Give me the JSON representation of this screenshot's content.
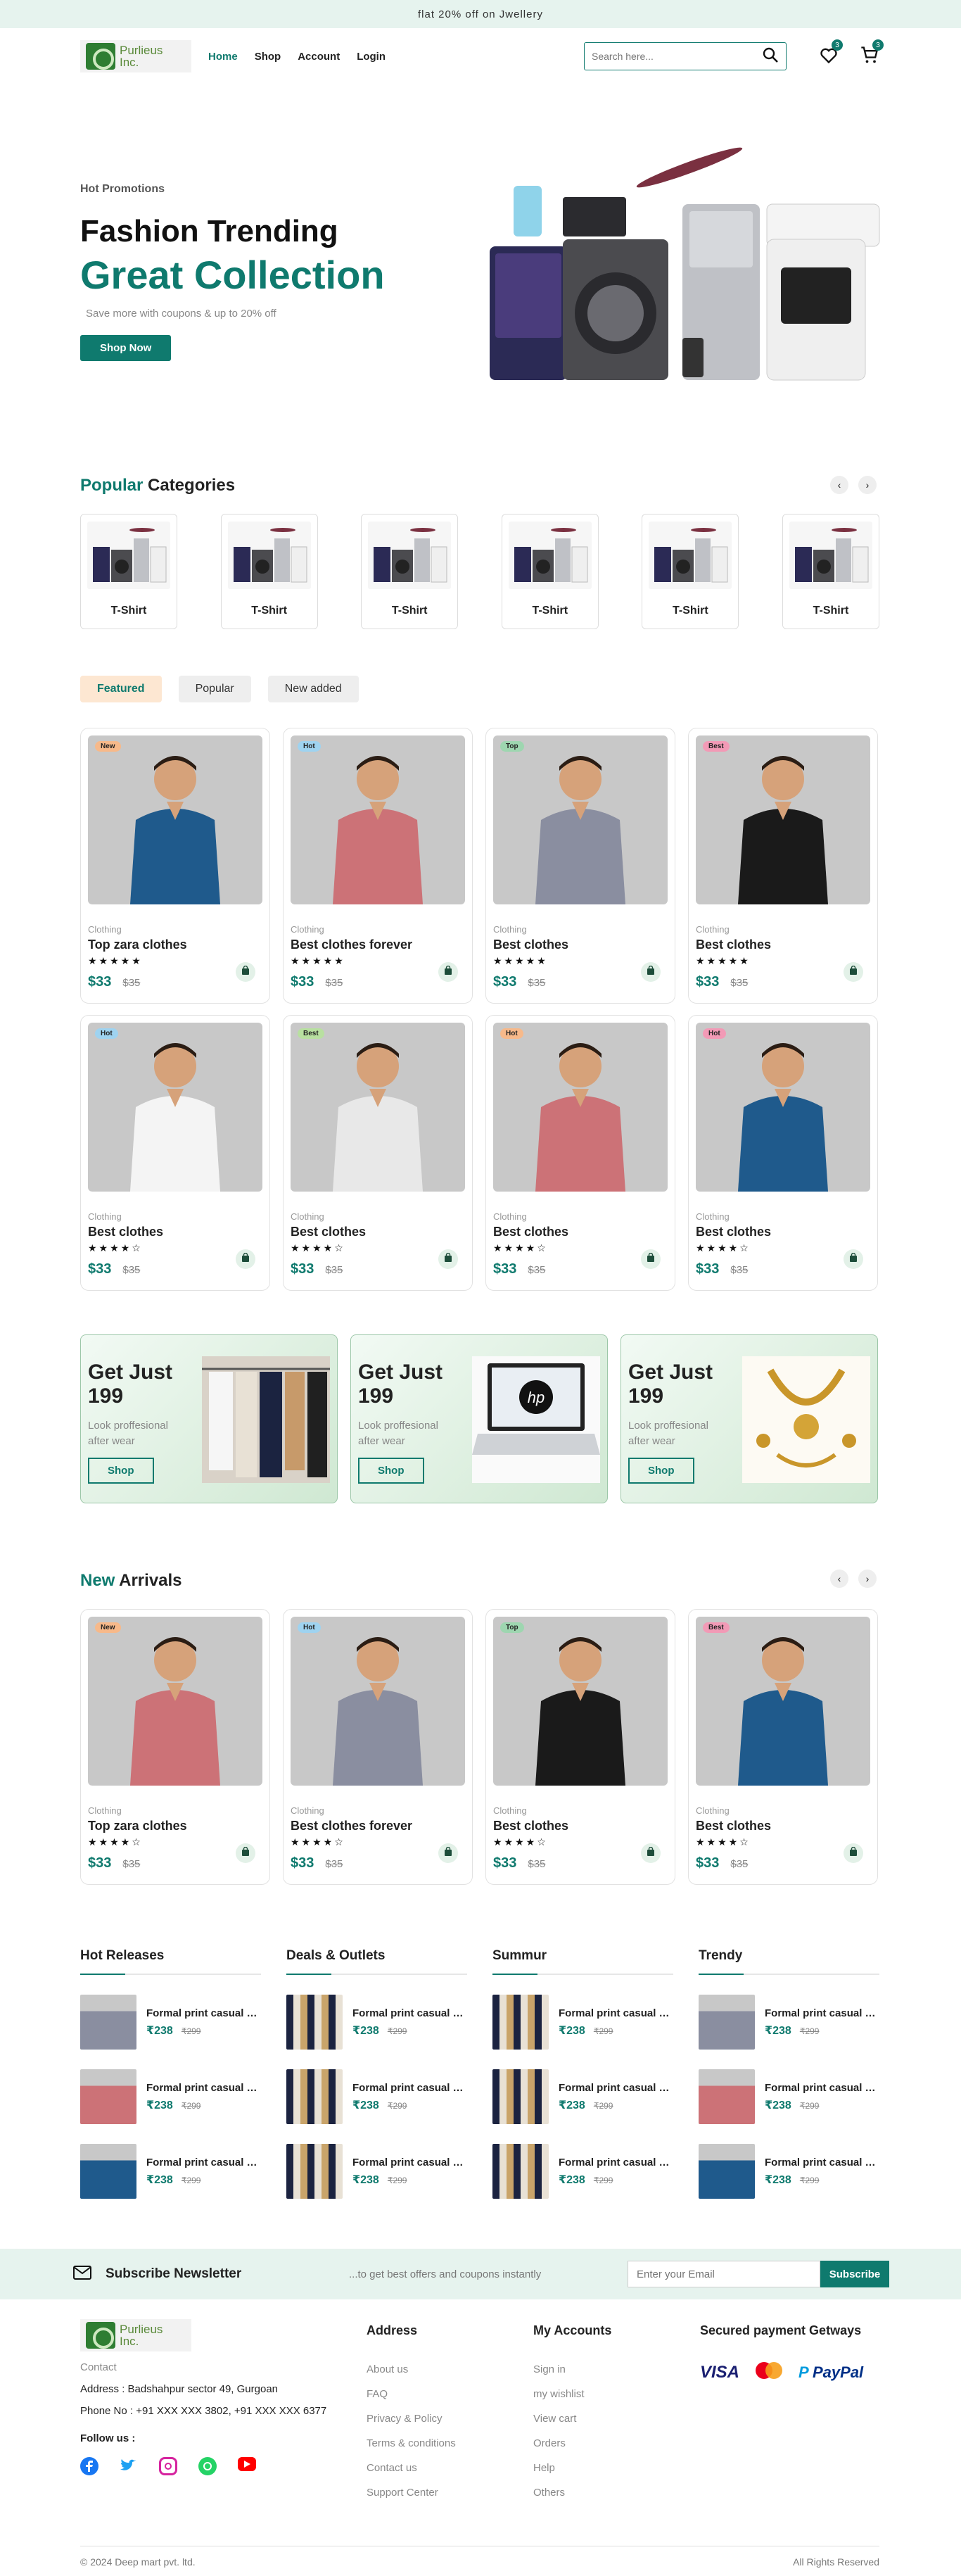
{
  "topbar": {
    "text": "flat 20% off on Jwellery"
  },
  "brand": {
    "logo_text_1": "Purlieus",
    "logo_text_2": "Inc."
  },
  "nav": {
    "home": "Home",
    "shop": "Shop",
    "account": "Account",
    "login": "Login"
  },
  "search": {
    "placeholder": "Search here..."
  },
  "badges": {
    "wishlist": "3",
    "cart": "3"
  },
  "hero": {
    "promo": "Hot Promotions",
    "title": "Fashion Trending",
    "subtitle": "Great Collection",
    "text": "Save more with coupons & up to 20% off",
    "button": "Shop Now"
  },
  "categories": {
    "title_accent": "Popular",
    "title_rest": " Categories",
    "items": [
      {
        "label": "T-Shirt"
      },
      {
        "label": "T-Shirt"
      },
      {
        "label": "T-Shirt"
      },
      {
        "label": "T-Shirt"
      },
      {
        "label": "T-Shirt"
      },
      {
        "label": "T-Shirt"
      }
    ]
  },
  "tabs": [
    "Featured",
    "Popular",
    "New added"
  ],
  "products_row1": [
    {
      "badge": "New",
      "badge_color": "#f7b98a",
      "category": "Clothing",
      "name": "Top zara clothes",
      "stars": "★★★★★",
      "price": "$33",
      "old": "$35",
      "shirt": "#1f5a8c"
    },
    {
      "badge": "Hot",
      "badge_color": "#9fd3f0",
      "category": "Clothing",
      "name": "Best clothes forever",
      "stars": "★★★★★",
      "price": "$33",
      "old": "$35",
      "shirt": "#cc7277"
    },
    {
      "badge": "Top",
      "badge_color": "#9ed6b0",
      "category": "Clothing",
      "name": "Best clothes",
      "stars": "★★★★★",
      "price": "$33",
      "old": "$35",
      "shirt": "#8a8ea0"
    },
    {
      "badge": "Best",
      "badge_color": "#f29ab6",
      "category": "Clothing",
      "name": "Best clothes",
      "stars": "★★★★★",
      "price": "$33",
      "old": "$35",
      "shirt": "#1a1a1a"
    }
  ],
  "products_row2": [
    {
      "badge": "Hot",
      "badge_color": "#9fd3f0",
      "category": "Clothing",
      "name": "Best clothes",
      "stars": "★★★★☆",
      "price": "$33",
      "old": "$35",
      "shirt": "#f4f4f4"
    },
    {
      "badge": "Best",
      "badge_color": "#b8e0a0",
      "category": "Clothing",
      "name": "Best clothes",
      "stars": "★★★★☆",
      "price": "$33",
      "old": "$35",
      "shirt": "#e8e8e8"
    },
    {
      "badge": "Hot",
      "badge_color": "#f7b98a",
      "category": "Clothing",
      "name": "Best clothes",
      "stars": "★★★★☆",
      "price": "$33",
      "old": "$35",
      "shirt": "#cc7277"
    },
    {
      "badge": "Hot",
      "badge_color": "#f29ab6",
      "category": "Clothing",
      "name": "Best clothes",
      "stars": "★★★★☆",
      "price": "$33",
      "old": "$35",
      "shirt": "#1f5a8c"
    }
  ],
  "banners": [
    {
      "title": "Get Just 199",
      "sub": "Look proffesional after wear",
      "button": "Shop"
    },
    {
      "title": "Get Just 199",
      "sub": "Look proffesional after wear",
      "button": "Shop"
    },
    {
      "title": "Get Just 199",
      "sub": "Look proffesional after wear",
      "button": "Shop"
    }
  ],
  "arrivals": {
    "title_accent": "New",
    "title_rest": " Arrivals",
    "items": [
      {
        "badge": "New",
        "badge_color": "#f7b98a",
        "category": "Clothing",
        "name": "Top zara clothes",
        "stars": "★★★★☆",
        "price": "$33",
        "old": "$35",
        "shirt": "#cc7277"
      },
      {
        "badge": "Hot",
        "badge_color": "#9fd3f0",
        "category": "Clothing",
        "name": "Best clothes forever",
        "stars": "★★★★☆",
        "price": "$33",
        "old": "$35",
        "shirt": "#8a8ea0"
      },
      {
        "badge": "Top",
        "badge_color": "#9ed6b0",
        "category": "Clothing",
        "name": "Best clothes",
        "stars": "★★★★☆",
        "price": "$33",
        "old": "$35",
        "shirt": "#1a1a1a"
      },
      {
        "badge": "Best",
        "badge_color": "#f29ab6",
        "category": "Clothing",
        "name": "Best clothes",
        "stars": "★★★★☆",
        "price": "$33",
        "old": "$35",
        "shirt": "#1f5a8c"
      }
    ]
  },
  "lists": [
    {
      "title": "Hot Releases",
      "items": [
        {
          "name": "Formal print casual c...",
          "price": "₹238",
          "old": "₹299",
          "color": "#8a8ea0"
        },
        {
          "name": "Formal print casual c...",
          "price": "₹238",
          "old": "₹299",
          "color": "#cc7277"
        },
        {
          "name": "Formal print casual c...",
          "price": "₹238",
          "old": "₹299",
          "color": "#1f5a8c"
        }
      ]
    },
    {
      "title": "Deals & Outlets",
      "items": [
        {
          "name": "Formal print casual c...",
          "price": "₹238",
          "old": "₹299",
          "color": "#c9a46a"
        },
        {
          "name": "Formal print casual c...",
          "price": "₹238",
          "old": "₹299",
          "color": "#c9a46a"
        },
        {
          "name": "Formal print casual c...",
          "price": "₹238",
          "old": "₹299",
          "color": "#c9a46a"
        }
      ]
    },
    {
      "title": "Summur",
      "items": [
        {
          "name": "Formal print casual c...",
          "price": "₹238",
          "old": "₹299",
          "color": "#c9a46a"
        },
        {
          "name": "Formal print casual c...",
          "price": "₹238",
          "old": "₹299",
          "color": "#c9a46a"
        },
        {
          "name": "Formal print casual c...",
          "price": "₹238",
          "old": "₹299",
          "color": "#c9a46a"
        }
      ]
    },
    {
      "title": "Trendy",
      "items": [
        {
          "name": "Formal print casual c...",
          "price": "₹238",
          "old": "₹299",
          "color": "#8a8ea0"
        },
        {
          "name": "Formal print casual c...",
          "price": "₹238",
          "old": "₹299",
          "color": "#cc7277"
        },
        {
          "name": "Formal print casual c...",
          "price": "₹238",
          "old": "₹299",
          "color": "#1f5a8c"
        }
      ]
    }
  ],
  "newsletter": {
    "title": "Subscribe Newsletter",
    "sub": "...to get best offers and coupons instantly",
    "placeholder": "Enter your Email",
    "button": "Subscribe"
  },
  "footer": {
    "contact": "Contact",
    "address": "Address : Badshahpur sector 49, Gurgoan",
    "phone": "Phone No : +91 XXX XXX 3802, +91 XXX XXX 6377",
    "follow": "Follow us :",
    "address_title": "Address",
    "address_links": [
      "About us",
      "FAQ",
      "Privacy & Policy",
      "Terms & conditions",
      "Contact us",
      "Support Center"
    ],
    "accounts_title": "My Accounts",
    "account_links": [
      "Sign in",
      "my wishlist",
      "View cart",
      "Orders",
      "Help",
      "Others"
    ],
    "payment_title": "Secured payment Getways",
    "visa": "VISA",
    "paypal": "PayPal",
    "copyright": "© 2024 Deep mart pvt. ltd.",
    "rights": "All Rights Reserved"
  },
  "colors": {
    "accent": "#0f7a6e",
    "bg_light": "#e6f3ee"
  }
}
